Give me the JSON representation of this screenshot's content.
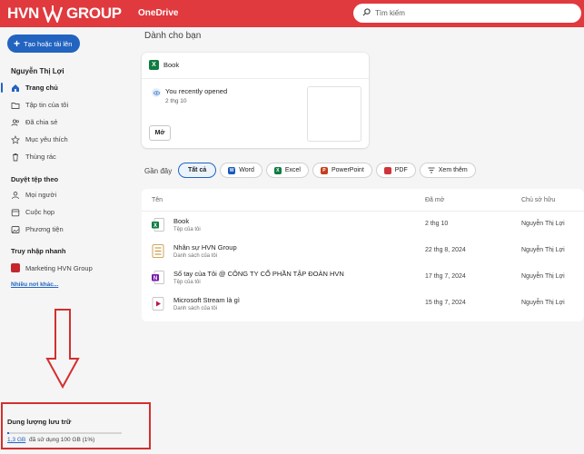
{
  "header": {
    "brand_left": "HVN",
    "brand_right": "GROUP",
    "app_name": "OneDrive",
    "search_placeholder": "Tìm kiếm",
    "accent_color": "#e0393e"
  },
  "sidebar": {
    "create_label": "Tạo hoặc tải lên",
    "user_name": "Nguyễn Thị Lợi",
    "items": [
      {
        "label": "Trang chủ",
        "icon": "home-icon",
        "active": true
      },
      {
        "label": "Tập tin của tôi",
        "icon": "folder-icon"
      },
      {
        "label": "Đã chia sẻ",
        "icon": "people-icon"
      },
      {
        "label": "Mục yêu thích",
        "icon": "star-icon"
      },
      {
        "label": "Thùng rác",
        "icon": "trash-icon"
      }
    ],
    "browse_title": "Duyệt tệp theo",
    "browse_items": [
      {
        "label": "Mọi người",
        "icon": "person-icon"
      },
      {
        "label": "Cuộc họp",
        "icon": "calendar-icon"
      },
      {
        "label": "Phương tiện",
        "icon": "image-icon"
      }
    ],
    "quick_title": "Truy nhập nhanh",
    "quick_items": [
      {
        "label": "Marketing HVN Group",
        "icon": "group-icon"
      }
    ],
    "more_label": "Nhiều nơi khác..."
  },
  "storage": {
    "title": "Dung lượng lưu trữ",
    "used": "1,3 GB",
    "detail": "đã sử dụng 100 GB (1%)",
    "fraction_used": 0.013
  },
  "main": {
    "title": "Dành cho bạn",
    "card": {
      "file_name": "Book",
      "reason": "You recently opened",
      "date": "2 thg 10",
      "open_label": "Mở"
    },
    "recent_label": "Gần đây",
    "filters": [
      {
        "label": "Tất cả",
        "active": true
      },
      {
        "label": "Word",
        "icon": "word-icon",
        "color": "#185abd"
      },
      {
        "label": "Excel",
        "icon": "excel-icon",
        "color": "#107c41"
      },
      {
        "label": "PowerPoint",
        "icon": "powerpoint-icon",
        "color": "#c43e1c"
      },
      {
        "label": "PDF",
        "icon": "pdf-icon",
        "color": "#d13438"
      },
      {
        "label": "Xem thêm",
        "icon": "filter-icon"
      }
    ],
    "table": {
      "headers": {
        "name": "Tên",
        "opened": "Đã mở",
        "owner": "Chủ sở hữu"
      },
      "rows": [
        {
          "name": "Book",
          "location": "Tệp của tôi",
          "opened": "2 thg 10",
          "owner": "Nguyễn Thị Lợi",
          "icon": "excel-file-icon"
        },
        {
          "name": "Nhân sự HVN Group",
          "location": "Danh sách của tôi",
          "opened": "22 thg 8, 2024",
          "owner": "Nguyễn Thị Lợi",
          "icon": "list-file-icon"
        },
        {
          "name": "Sổ tay của Tôi @ CÔNG TY CỔ PHẦN TẬP ĐOÀN HVN",
          "location": "Tệp của tôi",
          "opened": "17 thg 7, 2024",
          "owner": "Nguyễn Thị Lợi",
          "icon": "onenote-file-icon"
        },
        {
          "name": "Microsoft Stream là gì",
          "location": "Danh sách của tôi",
          "opened": "15 thg 7, 2024",
          "owner": "Nguyễn Thị Lợi",
          "icon": "stream-file-icon"
        }
      ]
    }
  }
}
